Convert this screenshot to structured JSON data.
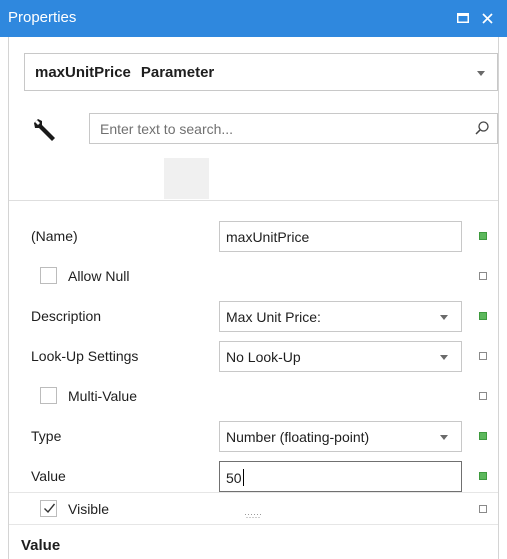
{
  "window": {
    "title": "Properties",
    "accent_color": "#2f88de"
  },
  "selector": {
    "object_name": "maxUnitPrice",
    "object_type": "Parameter"
  },
  "search": {
    "placeholder": "Enter text to search..."
  },
  "properties": [
    {
      "label": "(Name)",
      "kind": "text",
      "value": "maxUnitPrice",
      "modified": true
    },
    {
      "label": "Allow Null",
      "kind": "checkbox",
      "checked": false,
      "modified": false
    },
    {
      "label": "Description",
      "kind": "dropdown",
      "value": "Max Unit Price:",
      "modified": true
    },
    {
      "label": "Look-Up Settings",
      "kind": "dropdown",
      "value": "No Look-Up",
      "modified": false
    },
    {
      "label": "Multi-Value",
      "kind": "checkbox",
      "checked": false,
      "modified": false
    },
    {
      "label": "Type",
      "kind": "dropdown",
      "value": "Number (floating-point)",
      "modified": true
    },
    {
      "label": "Value",
      "kind": "text",
      "value": "50",
      "modified": true,
      "editing": true
    },
    {
      "label": "Visible",
      "kind": "checkbox",
      "checked": true,
      "modified": false
    }
  ],
  "description_panel": {
    "title": "Value"
  },
  "colors": {
    "modified_marker": "#5cb85c",
    "default_marker": "#ffffff"
  }
}
